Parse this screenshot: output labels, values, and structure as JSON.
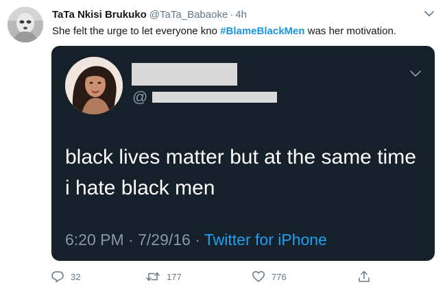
{
  "tweet": {
    "author_name": "TaTa Nkisi Brukuko",
    "author_handle": "@TaTa_Babaoke",
    "separator": "·",
    "timestamp": "4h",
    "text_before": "She felt the urge to let everyone kno ",
    "hashtag": "#BlameBlackMen",
    "text_after": " was her motivation.",
    "avatar_icon": "masked-person-avatar",
    "menu_icon": "chevron-down-icon"
  },
  "quoted_screenshot": {
    "handle_prefix": "@",
    "name_redacted": true,
    "handle_redacted": true,
    "text": "black lives matter but at the same time i hate black men",
    "time": "6:20 PM",
    "separator1": "·",
    "date": "7/29/16",
    "separator2": "·",
    "source": "Twitter for iPhone",
    "menu_icon": "chevron-down-icon",
    "colors": {
      "background": "#15202b",
      "text": "#ffffff",
      "muted": "#8899a6",
      "link": "#1da1f2"
    }
  },
  "actions": {
    "reply": {
      "icon": "reply-icon",
      "count": "32"
    },
    "retweet": {
      "icon": "retweet-icon",
      "count": "177"
    },
    "like": {
      "icon": "heart-icon",
      "count": "776"
    },
    "share": {
      "icon": "share-icon"
    }
  },
  "colors": {
    "hashtag": "#1b95e0",
    "muted": "#657786",
    "text": "#14171a"
  }
}
